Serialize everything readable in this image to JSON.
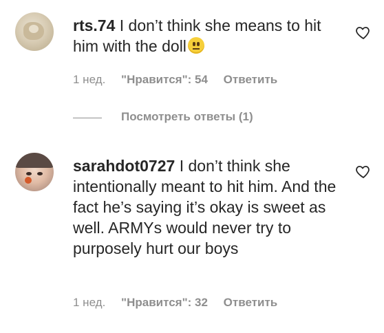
{
  "comments": [
    {
      "username": "rts.74",
      "text": " I don’t think she means to hit him with the doll",
      "emoji_icon": "neutral-face-emoji",
      "time": "1 нед.",
      "likes": "\"Нравится\": 54",
      "reply": "Ответить",
      "view_replies": "Посмотреть ответы (1)"
    },
    {
      "username": "sarahdot0727",
      "text": " I don’t think she intentionally meant to hit him. And the fact he’s saying it’s okay is sweet as well. ARMYs would never try to purposely hurt our boys",
      "time": "1 нед.",
      "likes": "\"Нравится\": 32",
      "reply": "Ответить"
    }
  ],
  "colors": {
    "text": "#262626",
    "secondary": "#8e8e8e",
    "background": "#ffffff"
  },
  "icons": [
    "heart-outline-icon"
  ]
}
